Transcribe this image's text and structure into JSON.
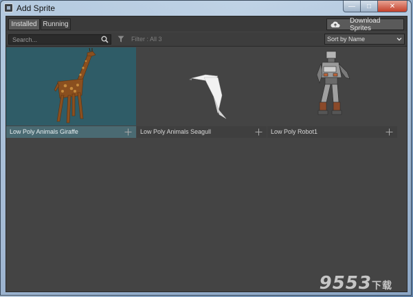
{
  "window": {
    "title": "Add Sprite",
    "min_glyph": "—",
    "max_glyph": "□",
    "close_glyph": "✕"
  },
  "tabs": [
    {
      "label": "Installed",
      "active": true
    },
    {
      "label": "Running",
      "active": false
    }
  ],
  "download_button": {
    "label": "Download Sprites",
    "icon": "cloud-upload-icon"
  },
  "search": {
    "placeholder": "Search...",
    "value": ""
  },
  "filter": {
    "text": "Filter : All 3",
    "icon": "funnel-icon"
  },
  "sort": {
    "selected": "Sort by Name"
  },
  "sprites": [
    {
      "label": "Low Poly Animals Giraffe",
      "selected": true
    },
    {
      "label": "Low Poly Animals Seagull",
      "selected": false
    },
    {
      "label": "Low Poly Robot1",
      "selected": false
    }
  ],
  "watermark": {
    "number": "9553",
    "suffix": "下载"
  },
  "colors": {
    "selected_bg": "#2f5c67",
    "panel_bg": "#444444"
  }
}
